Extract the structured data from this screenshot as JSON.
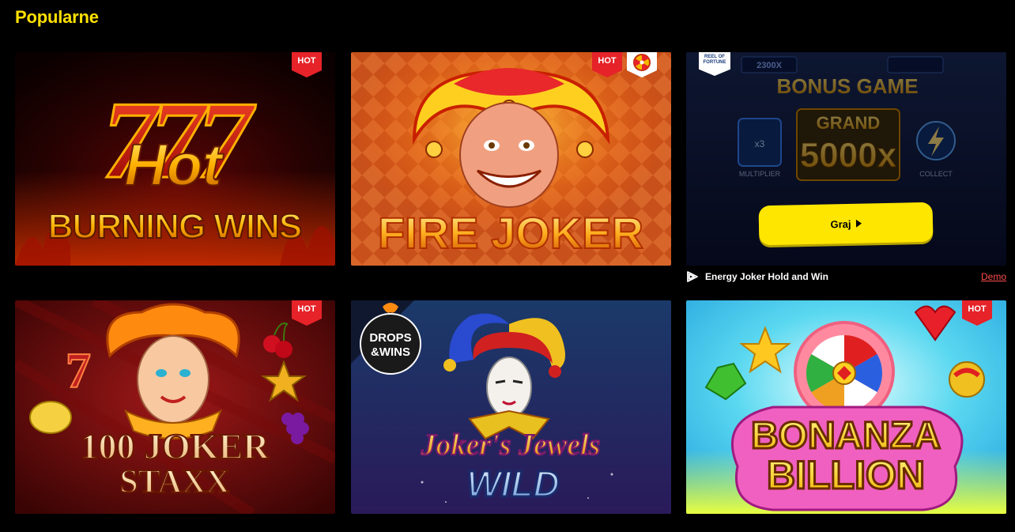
{
  "section": {
    "title": "Popularne"
  },
  "games": [
    {
      "title_line1": "777",
      "title_line2": "Hot",
      "title_line3": "BURNING WINS",
      "badge": "HOT"
    },
    {
      "title": "FIRE JOKER",
      "badge": "HOT",
      "extra_badge_icon": "wheel-of-fortune-icon"
    },
    {
      "reel_badge": "REEL OF FORTUNE",
      "bonus_title": "BONUS GAME",
      "grand_label": "GRAND",
      "grand_value": "5000x",
      "multiplier_value": "x3",
      "multiplier_label": "MULTIPLIER",
      "collect_label": "COLLECT",
      "play_label": "Graj",
      "caption": "Energy Joker Hold and Win",
      "demo_label": "Demo",
      "score_top": "2300X"
    },
    {
      "title_line1": "100 JOKER",
      "title_line2": "STAXX",
      "badge": "HOT"
    },
    {
      "title_line1": "Joker's Jewels",
      "title_line2": "WILD",
      "promo_line1": "DROPS",
      "promo_line2": "&WINS"
    },
    {
      "title_line1": "BONANZA",
      "title_line2": "BILLION",
      "badge": "HOT"
    }
  ],
  "colors": {
    "accent": "#ffe000",
    "hot": "#e52329",
    "demo": "#ff4d4d",
    "play": "#ffe600"
  }
}
